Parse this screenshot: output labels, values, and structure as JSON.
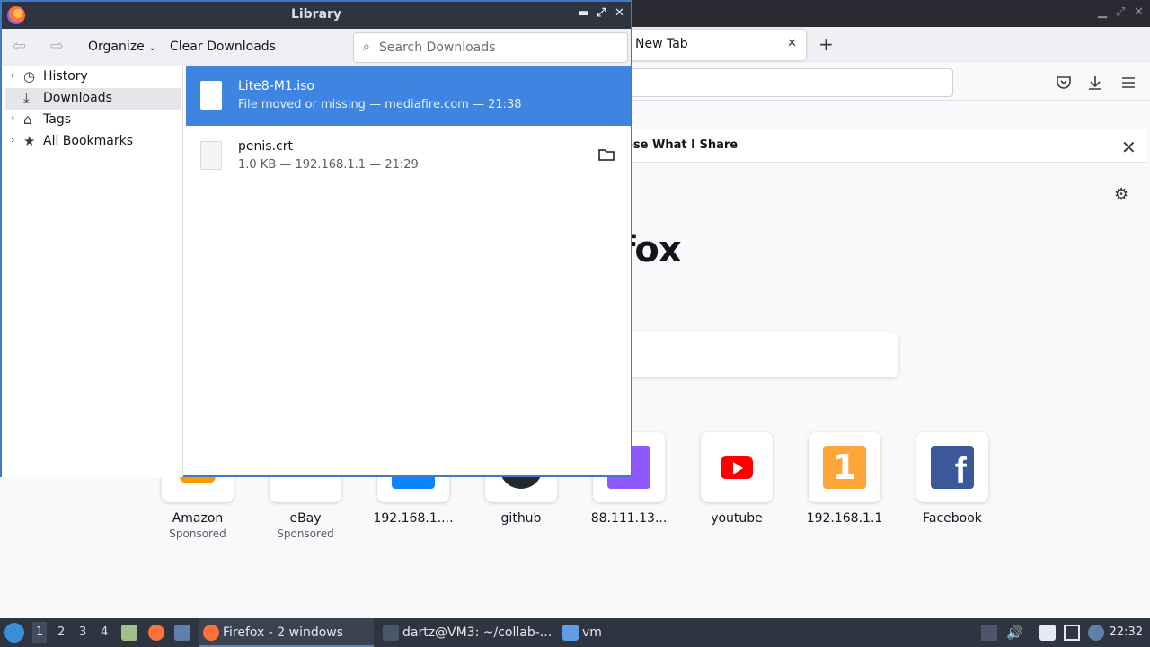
{
  "firefox": {
    "tab_title": "New Tab",
    "notification_text": "ose What I Share",
    "brand_partial": "fox",
    "tiles": [
      {
        "label": "Amazon",
        "sub": "Sponsored",
        "color": "#ff9900"
      },
      {
        "label": "eBay",
        "sub": "Sponsored",
        "color": "#ffffff"
      },
      {
        "label": "192.168.1....",
        "sub": "",
        "color": "#0a84ff"
      },
      {
        "label": "github",
        "sub": "",
        "color": "#24292f"
      },
      {
        "label": "88.111.13...",
        "sub": "",
        "color": "#9059ff"
      },
      {
        "label": "youtube",
        "sub": "",
        "color": "#ff0000"
      },
      {
        "label": "192.168.1.1",
        "sub": "",
        "color": "#ffa436"
      },
      {
        "label": "Facebook",
        "sub": "",
        "color": "#3b5998"
      }
    ]
  },
  "library": {
    "title": "Library",
    "toolbar": {
      "organize_label": "Organize",
      "clear_label": "Clear Downloads",
      "search_placeholder": "Search Downloads"
    },
    "sidebar": [
      {
        "label": "History",
        "icon": "clock-icon"
      },
      {
        "label": "Downloads",
        "icon": "download-icon"
      },
      {
        "label": "Tags",
        "icon": "tag-icon"
      },
      {
        "label": "All Bookmarks",
        "icon": "star-icon"
      }
    ],
    "downloads": [
      {
        "name": "Lite8-M1.iso",
        "status": "File moved or missing — mediafire.com — 21:38"
      },
      {
        "name": "penis.crt",
        "status": "1.0 KB — 192.168.1.1 — 21:29"
      }
    ]
  },
  "taskbar": {
    "workspaces": [
      "1",
      "2",
      "3",
      "4"
    ],
    "tasks": [
      {
        "label": "Firefox - 2 windows"
      },
      {
        "label": "dartz@VM3: ~/collab-..."
      },
      {
        "label": "vm"
      }
    ],
    "clock": "22:32"
  }
}
